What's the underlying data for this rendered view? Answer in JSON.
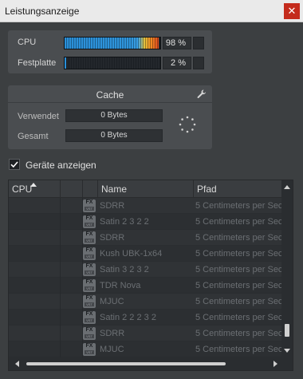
{
  "window": {
    "title": "Leistungsanzeige",
    "close_glyph": "✕"
  },
  "performance": {
    "cpu": {
      "label": "CPU",
      "value_text": "98 %",
      "level": 0.98
    },
    "disk": {
      "label": "Festplatte",
      "value_text": "2 %",
      "level": 0.02
    }
  },
  "cache": {
    "title": "Cache",
    "settings_icon": "wrench-icon",
    "used_label": "Verwendet",
    "used_value": "0 Bytes",
    "total_label": "Gesamt",
    "total_value": "0 Bytes"
  },
  "show_devices": {
    "label": "Geräte anzeigen",
    "checked": true
  },
  "table": {
    "columns": {
      "cpu": "CPU",
      "name": "Name",
      "path": "Pfad"
    },
    "rows": [
      {
        "icon_text": "FX",
        "icon_sub": "VST",
        "name": "SDRR",
        "path": "5 Centimeters per Sec"
      },
      {
        "icon_text": "FX",
        "icon_sub": "VST",
        "name": "Satin 2 3 2 2",
        "path": "5 Centimeters per Sec"
      },
      {
        "icon_text": "FX",
        "icon_sub": "VST",
        "name": "SDRR",
        "path": "5 Centimeters per Sec"
      },
      {
        "icon_text": "FX",
        "icon_sub": "VST",
        "name": "Kush UBK-1x64",
        "path": "5 Centimeters per Sec"
      },
      {
        "icon_text": "FX",
        "icon_sub": "VST",
        "name": "Satin 3 2 3 2",
        "path": "5 Centimeters per Sec"
      },
      {
        "icon_text": "FX",
        "icon_sub": "VST",
        "name": "TDR Nova",
        "path": "5 Centimeters per Sec"
      },
      {
        "icon_text": "FX",
        "icon_sub": "VST",
        "name": "MJUC",
        "path": "5 Centimeters per Sec"
      },
      {
        "icon_text": "FX",
        "icon_sub": "VST",
        "name": "Satin 2 2 2 3 2",
        "path": "5 Centimeters per Sec"
      },
      {
        "icon_text": "FX",
        "icon_sub": "VST",
        "name": "SDRR",
        "path": "5 Centimeters per Sec"
      },
      {
        "icon_text": "FX",
        "icon_sub": "VST",
        "name": "MJUC",
        "path": "5 Centimeters per Sec"
      }
    ]
  },
  "colors": {
    "meter_blue": "#2a8fd8",
    "meter_hot": "#e24a1e",
    "panel": "#4a4d50",
    "background": "#3c3f41"
  }
}
